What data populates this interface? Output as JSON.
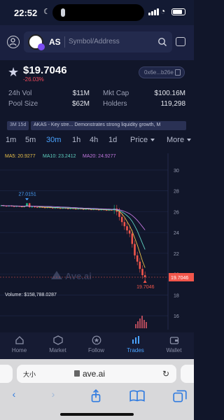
{
  "status": {
    "time": "22:52"
  },
  "header": {
    "symbol": "AS",
    "search_placeholder": "Symbol/Address"
  },
  "token": {
    "price": "$19.7046",
    "change": "-26.03%",
    "address": "0x6e...b26e"
  },
  "stats": [
    {
      "label": "24h Vol",
      "value": "$11M"
    },
    {
      "label": "Mkt Cap",
      "value": "$100.16M"
    },
    {
      "label": "Pool Size",
      "value": "$62M"
    },
    {
      "label": "Holders",
      "value": "119,298"
    }
  ],
  "tags": {
    "age": "3M 15d",
    "insight": "AKAS - Key stre... Demonstrates strong liquidity growth, M"
  },
  "timeframes": [
    "1m",
    "5m",
    "30m",
    "1h",
    "4h",
    "1d"
  ],
  "active_timeframe": "30m",
  "selectors": {
    "price": "Price",
    "more": "More"
  },
  "chart_data": {
    "type": "candlestick",
    "ma_labels": [
      {
        "label": "MA5: 20.9277",
        "color": "#e8c04a"
      },
      {
        "label": "MA10: 23.2412",
        "color": "#5fd0c0"
      },
      {
        "label": "MA20: 24.9277",
        "color": "#c478e0"
      }
    ],
    "y_ticks": [
      30,
      28,
      26,
      24,
      22,
      20,
      18,
      16
    ],
    "ylim": [
      15.2,
      30.8
    ],
    "current_price": "19.7046",
    "high_label": "27.0151",
    "low_label": "19.7046",
    "high": 27.0151,
    "low": 19.7046,
    "watermark": "Ave.ai",
    "volume_label": "Volume: $158,788.0287",
    "colors": {
      "up": "#1fbf8a",
      "down": "#f2564b",
      "ma5": "#e8c04a",
      "ma10": "#5fd0c0",
      "ma20": "#c478e0"
    }
  },
  "tabbar": [
    {
      "label": "Home",
      "icon": "home-icon"
    },
    {
      "label": "Market",
      "icon": "market-icon"
    },
    {
      "label": "Follow",
      "icon": "follow-icon"
    },
    {
      "label": "Trades",
      "icon": "trades-icon"
    },
    {
      "label": "Wallet",
      "icon": "wallet-icon"
    }
  ],
  "active_tab": "Trades",
  "browser": {
    "text_size": "大小",
    "url": "ave.ai"
  }
}
